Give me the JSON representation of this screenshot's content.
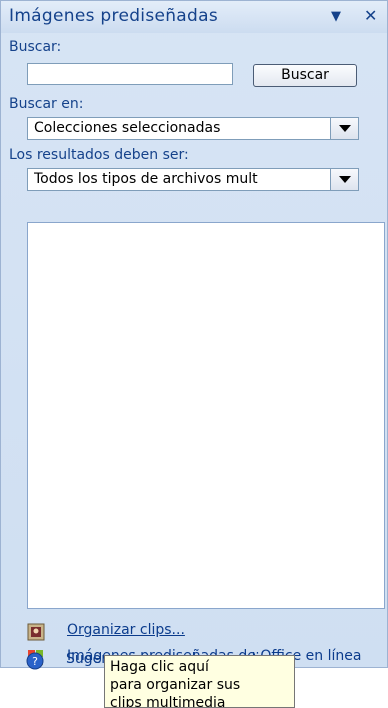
{
  "panel": {
    "title": "Imágenes prediseñadas",
    "menu_icon": "dropdown-arrow-icon",
    "close_icon": "close-icon"
  },
  "search": {
    "label": "Buscar:",
    "value": "",
    "button_label": "Buscar"
  },
  "search_in": {
    "label": "Buscar en:",
    "selected": "Colecciones seleccionadas"
  },
  "results_type": {
    "label": "Los resultados deben ser:",
    "selected": "Todos los tipos de archivos mult"
  },
  "links": [
    {
      "label": "Organizar clips...",
      "icon": "organize-clips-icon"
    },
    {
      "label": "Imágenes prediseñadas de Office en línea",
      "icon": "office-online-icon"
    },
    {
      "label": "Sugerencias para buscar clips",
      "icon": "help-icon"
    }
  ],
  "tooltip": {
    "lines": [
      "Haga clic aquí",
      "para organizar sus",
      "clips multimedia"
    ]
  },
  "colors": {
    "panel_bg": "#d7e4f4",
    "title_text": "#15428b",
    "link": "#0b3b8c",
    "tooltip_bg": "#ffffe1"
  }
}
